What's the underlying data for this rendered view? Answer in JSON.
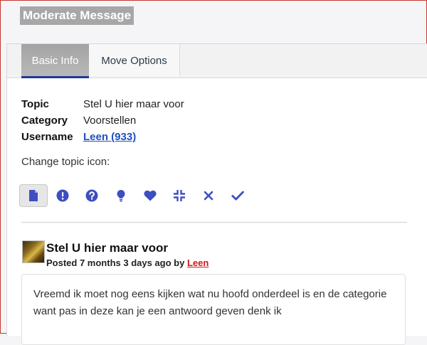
{
  "page": {
    "title": "Moderate Message"
  },
  "tabs": [
    {
      "label": "Basic Info",
      "active": true
    },
    {
      "label": "Move Options",
      "active": false
    }
  ],
  "info": {
    "topic_label": "Topic",
    "topic_value": "Stel U hier maar voor",
    "category_label": "Category",
    "category_value": "Voorstellen",
    "username_label": "Username",
    "username_value": "Leen (933)"
  },
  "change_icon_label": "Change topic icon:",
  "topic_icons": [
    {
      "name": "document-icon",
      "selected": true
    },
    {
      "name": "exclamation-icon",
      "selected": false
    },
    {
      "name": "question-icon",
      "selected": false
    },
    {
      "name": "lightbulb-icon",
      "selected": false
    },
    {
      "name": "heart-icon",
      "selected": false
    },
    {
      "name": "compress-icon",
      "selected": false
    },
    {
      "name": "close-icon",
      "selected": false
    },
    {
      "name": "check-icon",
      "selected": false
    }
  ],
  "colors": {
    "icon": "#3d4fbf",
    "link": "#1f4fbf",
    "author": "#d01818",
    "tab_accent": "#1f3a93"
  },
  "post": {
    "title": "Stel U hier maar voor",
    "meta_prefix": "Posted 7 months 3 days ago by",
    "author": "Leen",
    "body": "Vreemd ik moet nog eens kijken wat nu hoofd onderdeel is en de categorie want pas in deze kan je een antwoord geven denk ik"
  }
}
